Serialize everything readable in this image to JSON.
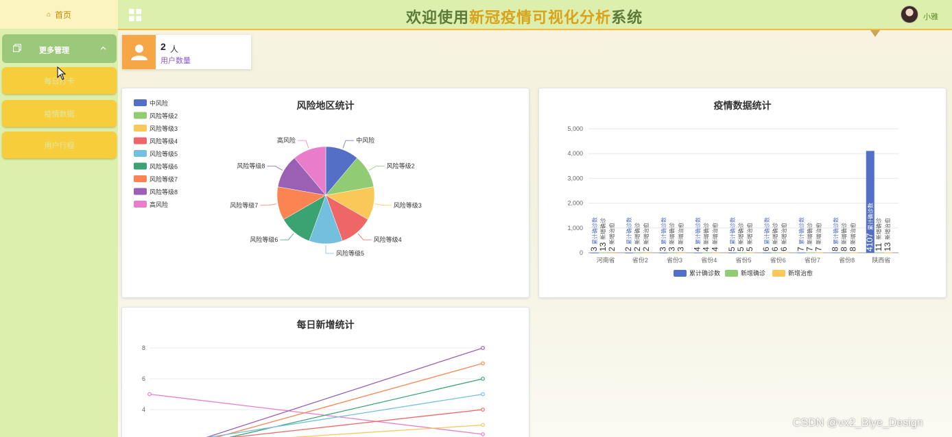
{
  "sidebar": {
    "home_label": "首页",
    "group_label": "更多管理",
    "items": [
      {
        "label": "每日打卡"
      },
      {
        "label": "疫情数据"
      },
      {
        "label": "用户行程"
      }
    ]
  },
  "header": {
    "title_part1": "欢迎使用",
    "title_part2": "新冠疫情",
    "title_part3": "可视化",
    "title_part4": "分析",
    "title_part5": "系统",
    "user_name": "小雅"
  },
  "stat": {
    "value": "2",
    "unit": "人",
    "label": "用户数量"
  },
  "colors": {
    "palette": [
      "#5470c6",
      "#91cc75",
      "#fac858",
      "#ee6666",
      "#73c0de",
      "#3ba272",
      "#fc8452",
      "#9a60b4",
      "#ea7ccc"
    ],
    "sidebar_bg": "#dcefad",
    "accent": "#f8cd3c"
  },
  "chart_data": [
    {
      "type": "pie",
      "title": "风险地区统计",
      "legend_position": "top-left",
      "categories": [
        "中风险",
        "风险等级2",
        "风险等级3",
        "风险等级4",
        "风险等级5",
        "风险等级6",
        "风险等级7",
        "风险等级8",
        "高风险"
      ],
      "values": [
        1,
        1,
        1,
        1,
        1,
        1,
        1,
        1,
        1
      ]
    },
    {
      "type": "bar",
      "title": "疫情数据统计",
      "categories": [
        "河南省",
        "省份2",
        "省份3",
        "省份4",
        "省份5",
        "省份6",
        "省份7",
        "省份8",
        "陕西省"
      ],
      "series": [
        {
          "name": "累计确诊数",
          "values": [
            3,
            2,
            3,
            4,
            5,
            6,
            7,
            8,
            4107
          ],
          "label_text": "累计确诊数"
        },
        {
          "name": "新增确诊",
          "values": [
            13,
            2,
            3,
            4,
            5,
            6,
            7,
            8,
            11
          ],
          "label_text": "新增确诊"
        },
        {
          "name": "新增治愈",
          "values": [
            2,
            2,
            3,
            4,
            5,
            6,
            7,
            8,
            13
          ],
          "label_text": "新增治愈"
        }
      ],
      "ylim": [
        0,
        5000
      ],
      "yticks": [
        "0",
        "1,000",
        "2,000",
        "3,000",
        "4,000",
        "5,000"
      ],
      "legend_position": "bottom"
    },
    {
      "type": "line",
      "title": "每日新增统计",
      "yticks": [
        "4",
        "6",
        "8"
      ],
      "ylim": [
        2,
        9
      ],
      "series": [
        {
          "values": [
            5,
            2.4
          ],
          "label": ""
        },
        {
          "values": [
            1,
            8
          ]
        },
        {
          "values": [
            1,
            7
          ]
        },
        {
          "values": [
            1,
            6
          ]
        },
        {
          "values": [
            1.6,
            5
          ]
        },
        {
          "values": [
            1.6,
            4
          ]
        },
        {
          "values": [
            1.6,
            3
          ]
        }
      ]
    }
  ]
}
